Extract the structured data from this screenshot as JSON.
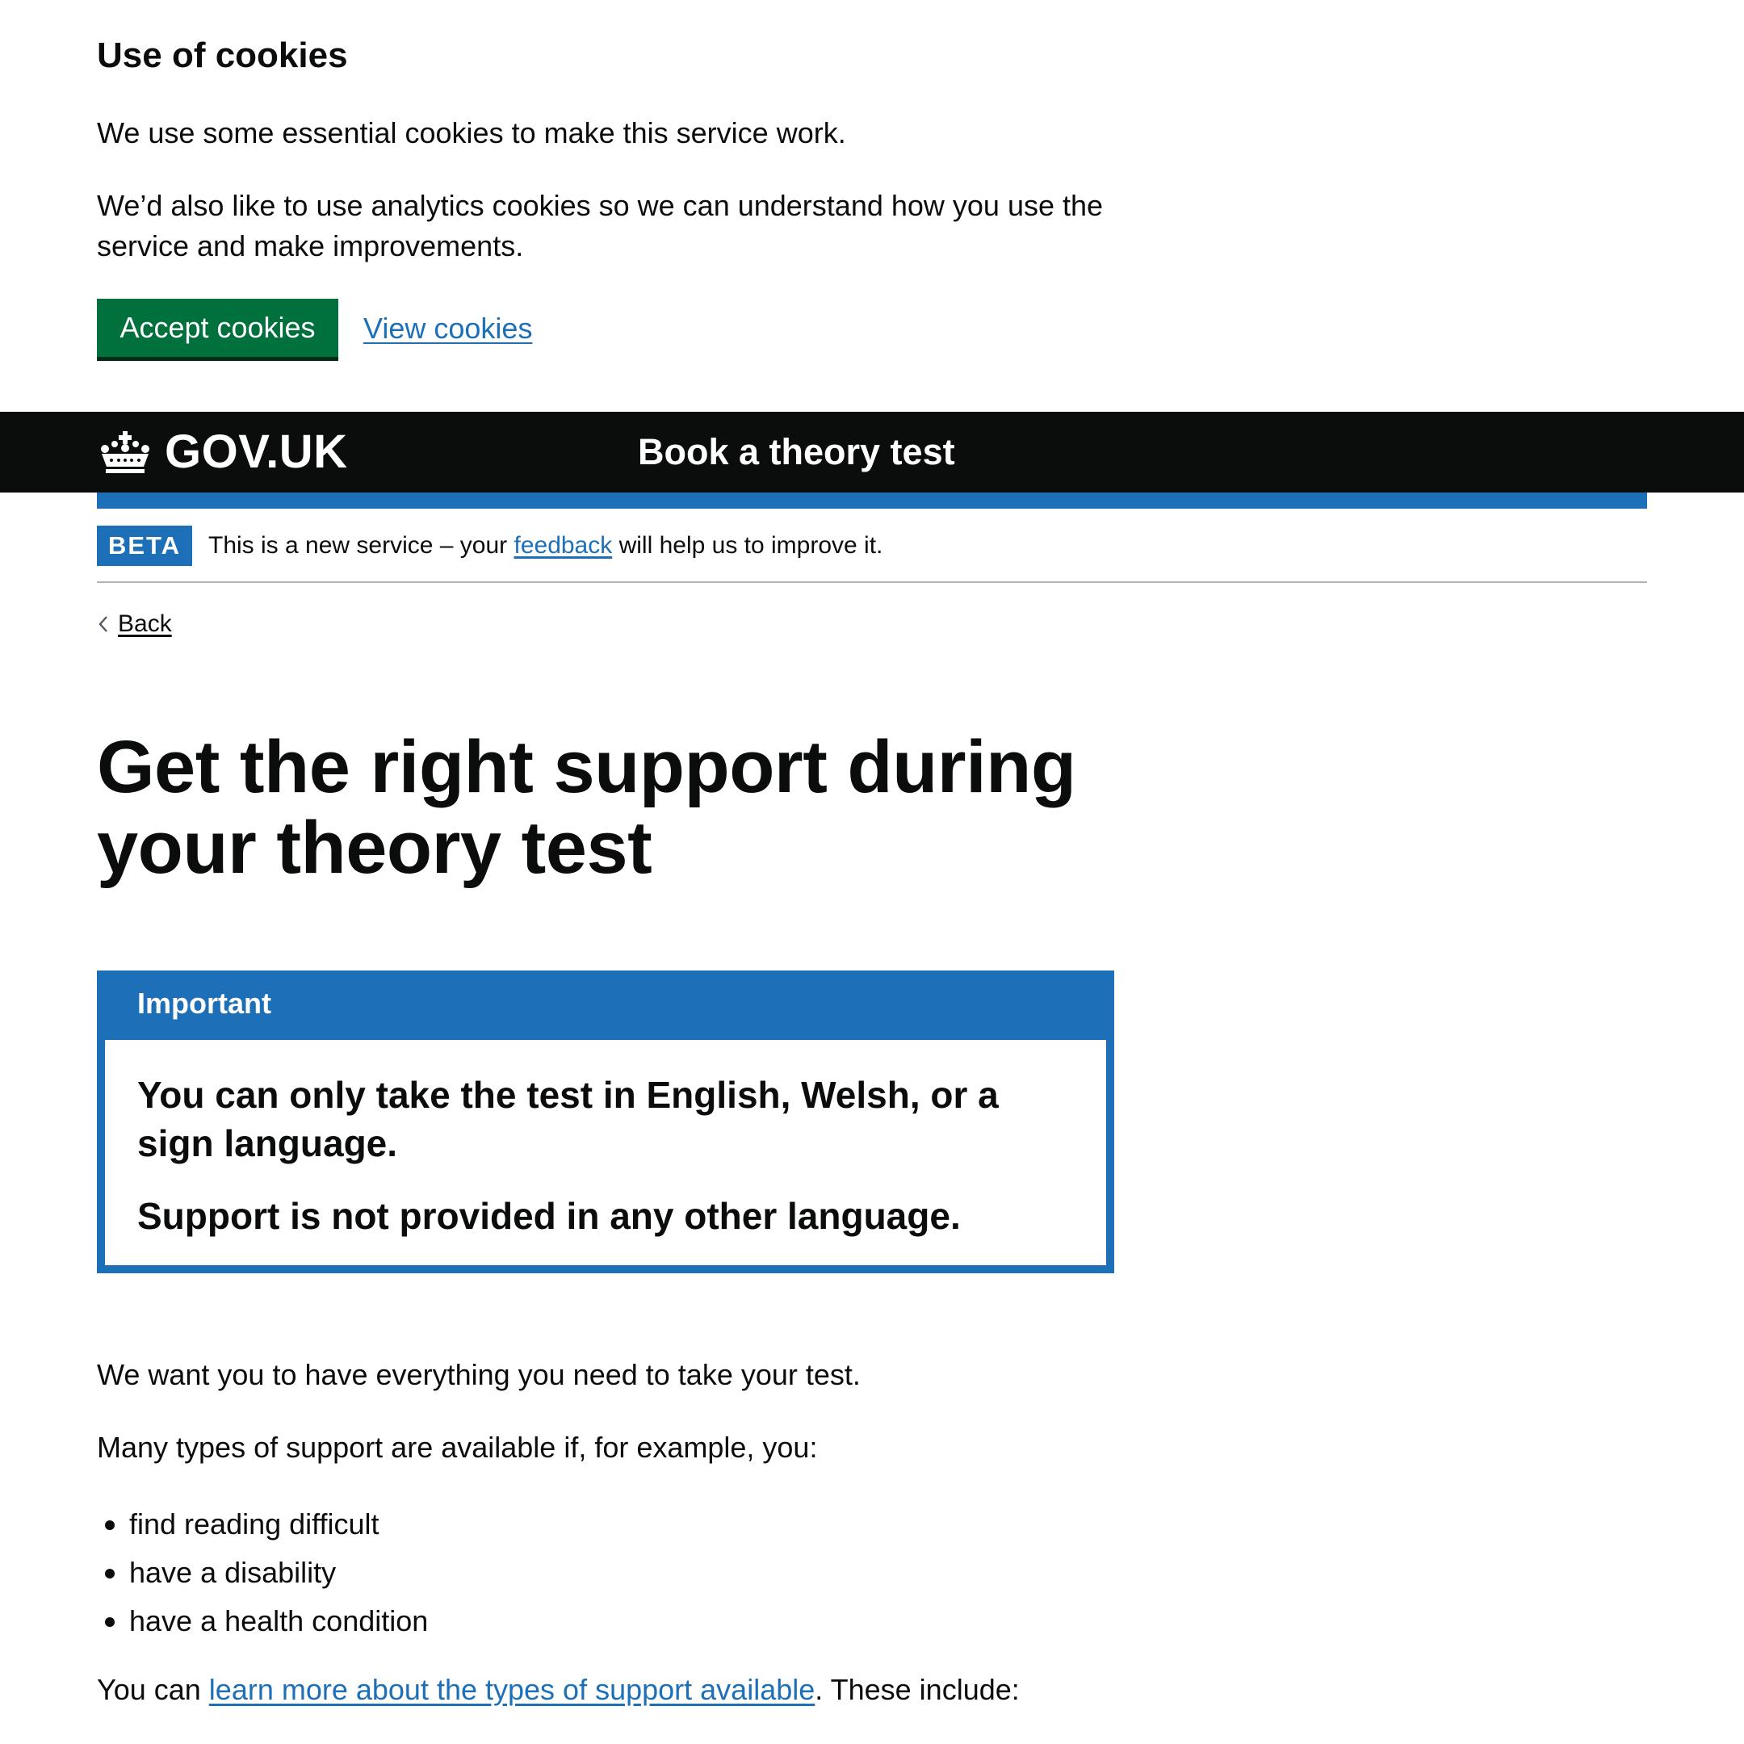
{
  "cookie_banner": {
    "title": "Use of cookies",
    "text_essential": "We use some essential cookies to make this service work.",
    "text_analytics": "We’d also like to use analytics cookies so we can understand how you use the service and make improvements.",
    "accept_label": "Accept cookies",
    "view_label": "View cookies"
  },
  "header": {
    "logo_text": "GOV.UK",
    "logo_icon": "crown-icon",
    "service_name": "Book a theory test"
  },
  "phase_banner": {
    "tag": "BETA",
    "text_before": "This is a new service – your ",
    "link": "feedback",
    "text_after": " will help us to improve it."
  },
  "back_link": {
    "label": "Back",
    "icon": "chevron-left-icon"
  },
  "main": {
    "title": "Get the right support during your theory test",
    "notification": {
      "title": "Important",
      "line1": "You can only take the test in English, Welsh, or a sign language.",
      "line2": "Support is not provided in any other language."
    },
    "paragraph1": "We want you to have everything you need to take your test.",
    "paragraph2": "Many types of support are available if, for example, you:",
    "list": [
      "find reading difficult",
      "have a disability",
      "have a health condition"
    ],
    "paragraph3_before": "You can ",
    "paragraph3_link": "learn more about the types of support available",
    "paragraph3_after": ". These include:"
  },
  "colors": {
    "brand_blue": "#1d70b8",
    "button_green": "#00703c",
    "header_black": "#0b0c0c",
    "text": "#0b0c0c"
  }
}
